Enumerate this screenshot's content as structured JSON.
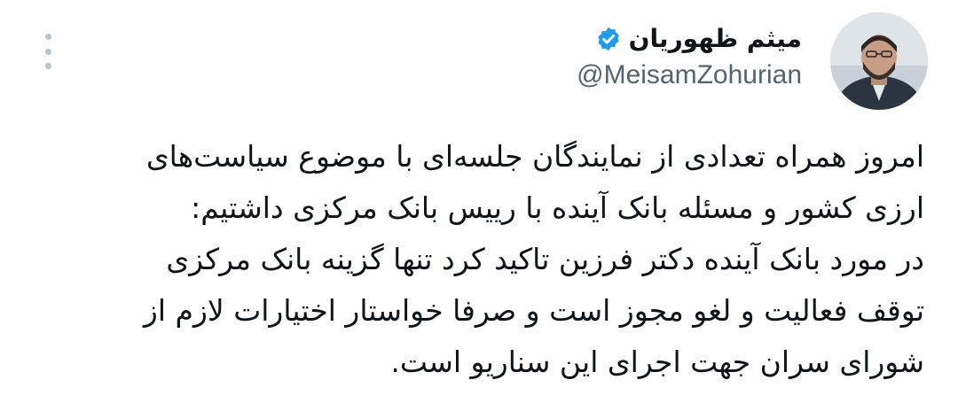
{
  "author": {
    "display_name": "میثم ظهوریان",
    "handle": "@MeisamZohurian",
    "verified": true,
    "verified_color": "#1d9bf0"
  },
  "tweet": {
    "lines": [
      "امروز همراه تعدادی از نمایندگان جلسه‌ای با موضوع سیاست‌های",
      "ارزی کشور و مسئله بانک آینده با رییس بانک مرکزی داشتیم:",
      "در مورد بانک آینده دکتر فرزین تاکید کرد تنها گزینه بانک مرکزی",
      "توقف فعالیت و لغو مجوز است و صرفا خواستار اختیارات لازم از",
      "شورای سران جهت اجرای این سناریو است."
    ]
  },
  "icons": {
    "verified": "verified-badge-icon",
    "more": "more-options-icon"
  },
  "colors": {
    "text_primary": "#0f1419",
    "text_secondary": "#536471",
    "background": "#ffffff"
  }
}
